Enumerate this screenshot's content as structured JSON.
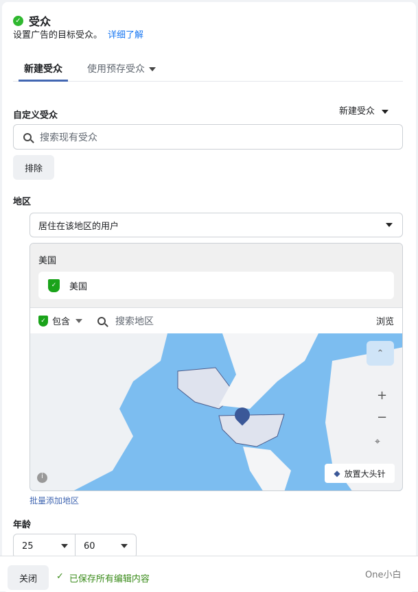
{
  "header": {
    "title": "受众",
    "subtitle": "设置广告的目标受众。",
    "learn_more": "详细了解"
  },
  "tabs": [
    {
      "label": "新建受众"
    },
    {
      "label": "使用预存受众"
    }
  ],
  "custom_audience": {
    "label": "自定义受众",
    "create_menu": "新建受众",
    "search_placeholder": "搜索现有受众",
    "exclude_label": "排除"
  },
  "location": {
    "label": "地区",
    "type_select": "居住在该地区的用户",
    "group_title": "美国",
    "selected": [
      {
        "name": "美国"
      }
    ],
    "include_label": "包含",
    "search_placeholder": "搜索地区",
    "browse_label": "浏览",
    "drop_pin_label": "放置大头针",
    "bulk_add_label": "批量添加地区"
  },
  "age": {
    "label": "年龄",
    "min": "25",
    "max": "60"
  },
  "footer": {
    "close_label": "关闭",
    "saved_status": "已保存所有编辑内容",
    "watermark": "One小白"
  },
  "colors": {
    "accent": "#4267b2",
    "link": "#1877f2",
    "success": "#2fb82f",
    "map_water": "#7cbdf0"
  }
}
